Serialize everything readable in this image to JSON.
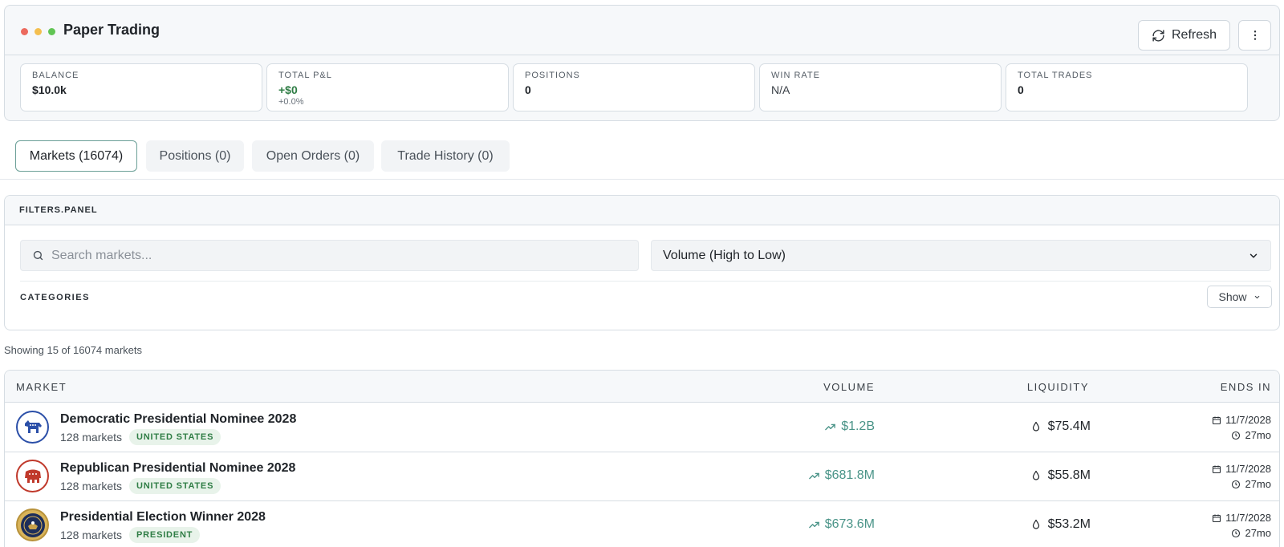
{
  "app": {
    "title": "Paper Trading",
    "refresh_label": "Refresh",
    "window_dots": [
      "#ec6a5e",
      "#f4bf4f",
      "#61c554"
    ]
  },
  "stats": [
    {
      "label": "BALANCE",
      "value": "$10.0k",
      "sub": ""
    },
    {
      "label": "TOTAL P&L",
      "value": "+$0",
      "sub": "+0.0%"
    },
    {
      "label": "POSITIONS",
      "value": "0",
      "sub": ""
    },
    {
      "label": "WIN RATE",
      "value": "N/A",
      "sub": ""
    },
    {
      "label": "TOTAL TRADES",
      "value": "0",
      "sub": ""
    }
  ],
  "tabs": [
    {
      "label": "Markets (16074)",
      "active": true
    },
    {
      "label": "Positions (0)",
      "active": false
    },
    {
      "label": "Open Orders (0)",
      "active": false
    },
    {
      "label": "Trade History (0)",
      "active": false
    }
  ],
  "filters": {
    "title": "FILTERS.PANEL",
    "search_placeholder": "Search markets...",
    "sort_value": "Volume (High to Low)",
    "categories_label": "CATEGORIES",
    "show_label": "Show"
  },
  "showing_text": "Showing 15 of 16074 markets",
  "table": {
    "headers": {
      "market": "MARKET",
      "volume": "VOLUME",
      "liquidity": "LIQUIDITY",
      "ends_in": "ENDS IN"
    },
    "rows": [
      {
        "title": "Democratic Presidential Nominee 2028",
        "sub": "128 markets",
        "badge": "UNITED STATES",
        "volume": "$1.2B",
        "liquidity": "$75.4M",
        "end_date": "11/7/2028",
        "time_left": "27mo",
        "icon": "democrat-donkey-icon"
      },
      {
        "title": "Republican Presidential Nominee 2028",
        "sub": "128 markets",
        "badge": "UNITED STATES",
        "volume": "$681.8M",
        "liquidity": "$55.8M",
        "end_date": "11/7/2028",
        "time_left": "27mo",
        "icon": "republican-elephant-icon"
      },
      {
        "title": "Presidential Election Winner 2028",
        "sub": "128 markets",
        "badge": "PRESIDENT",
        "volume": "$673.6M",
        "liquidity": "$53.2M",
        "end_date": "11/7/2028",
        "time_left": "27mo",
        "icon": "presidential-seal-icon"
      }
    ]
  },
  "colors": {
    "accent": "#4a9488",
    "positive": "#2f7d45",
    "badge_bg": "#e8f3ea"
  }
}
